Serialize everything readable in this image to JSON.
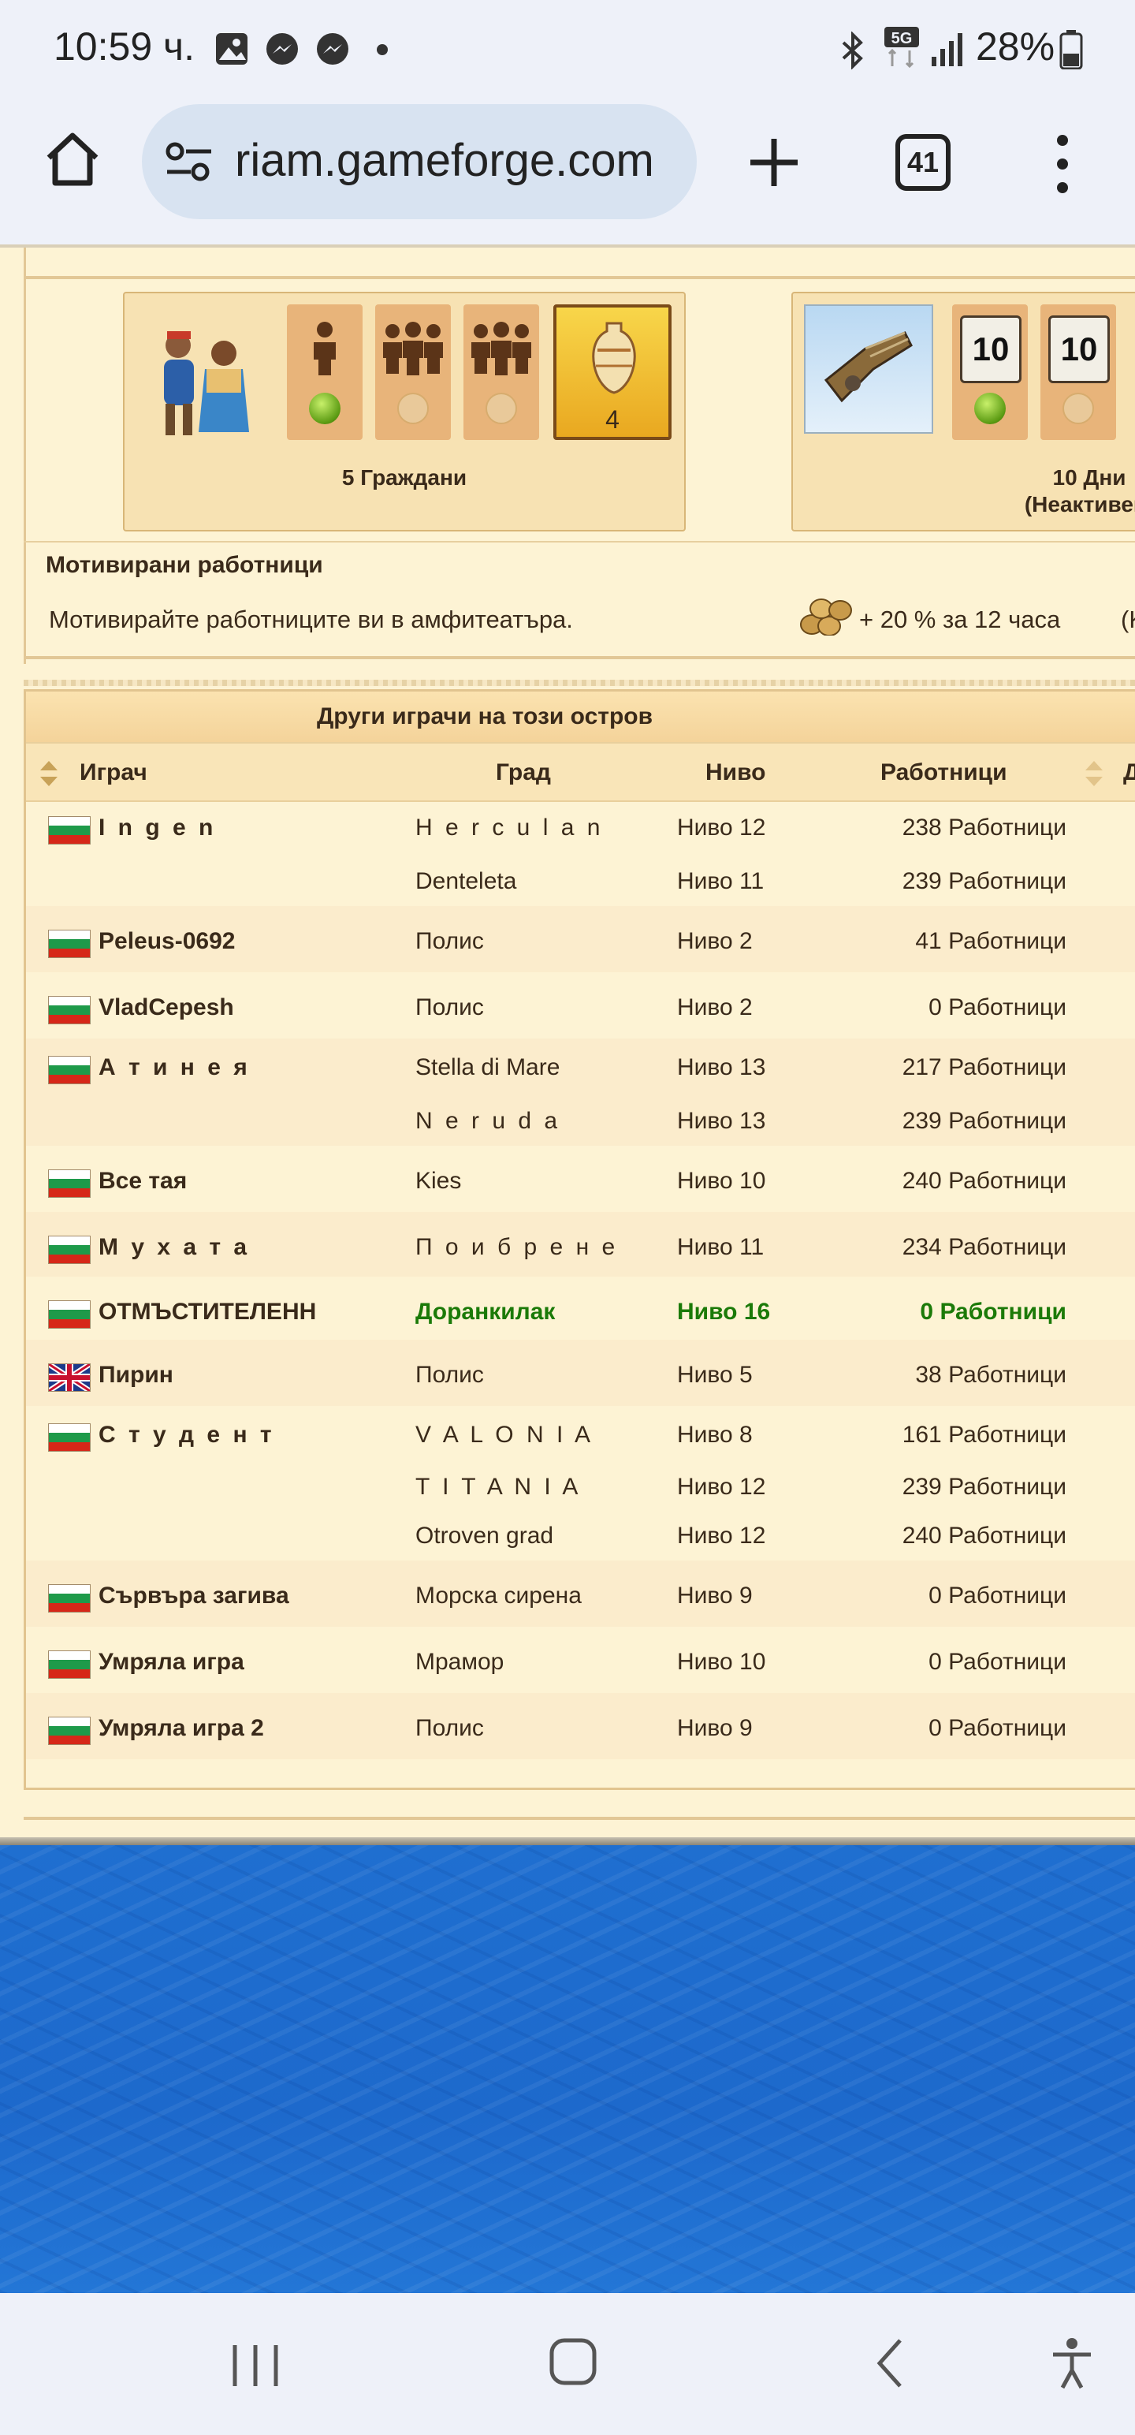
{
  "status_bar": {
    "time": "10:59 ч.",
    "battery": "28%"
  },
  "browser": {
    "url": "riam.gameforge.com",
    "tab_count": "41"
  },
  "citizens_card": {
    "level_value": "4",
    "caption": "5 Граждани"
  },
  "days_card": {
    "cal_value_1": "10",
    "cal_value_2": "10",
    "caption_line1": "10 Дни",
    "caption_line2": "(Неактивен)"
  },
  "motivation": {
    "title": "Мотивирани работници",
    "text": "Мотивирайте работниците ви в амфитеатъра.",
    "bonus": "+ 20 % за 12 часа",
    "cut_text": "(K"
  },
  "players_table": {
    "title": "Други играчи на този остров",
    "headers": {
      "player": "Играч",
      "city": "Град",
      "level": "Ниво",
      "workers": "Работници",
      "cut": "Д"
    },
    "rows": [
      {
        "player": "I n g e n",
        "city": "H e r c u l a n",
        "level": "Ниво 12",
        "workers": "238 Работници"
      },
      {
        "player": "",
        "city": "Denteleta",
        "level": "Ниво 11",
        "workers": "239 Работници"
      },
      {
        "player": "Peleus-0692",
        "city": "Полис",
        "level": "Ниво 2",
        "workers": "41 Работници"
      },
      {
        "player": "VladCepesh",
        "city": "Полис",
        "level": "Ниво 2",
        "workers": "0 Работници"
      },
      {
        "player": "А т и н е я",
        "city": "Stella di Mare",
        "level": "Ниво 13",
        "workers": "217 Работници"
      },
      {
        "player": "",
        "city": "N e r u d a",
        "level": "Ниво 13",
        "workers": "239 Работници"
      },
      {
        "player": "Все тая",
        "city": "Kies",
        "level": "Ниво 10",
        "workers": "240 Работници"
      },
      {
        "player": "М у х а т а",
        "city": "П о и б р е н е",
        "level": "Ниво 11",
        "workers": "234 Работници"
      },
      {
        "player": "ОТМЪСТИТЕЛЕНН",
        "city": "Доранкилак",
        "level": "Ниво 16",
        "workers": "0 Работници"
      },
      {
        "player": "Пирин",
        "city": "Полис",
        "level": "Ниво 5",
        "workers": "38 Работници"
      },
      {
        "player": "С т у д е н т",
        "city": "V A L O N I A",
        "level": "Ниво 8",
        "workers": "161 Работници"
      },
      {
        "player": "",
        "city": "T I T A N I A",
        "level": "Ниво 12",
        "workers": "239 Работници"
      },
      {
        "player": "",
        "city": "Otroven grad",
        "level": "Ниво 12",
        "workers": "240 Работници"
      },
      {
        "player": "Сървъра загива",
        "city": "Морска сирена",
        "level": "Ниво 9",
        "workers": "0 Работници"
      },
      {
        "player": "Умряла игра",
        "city": "Мрамор",
        "level": "Ниво 10",
        "workers": "0 Работници"
      },
      {
        "player": "Умряла игра 2",
        "city": "Полис",
        "level": "Ниво 9",
        "workers": "0 Работници"
      }
    ]
  }
}
